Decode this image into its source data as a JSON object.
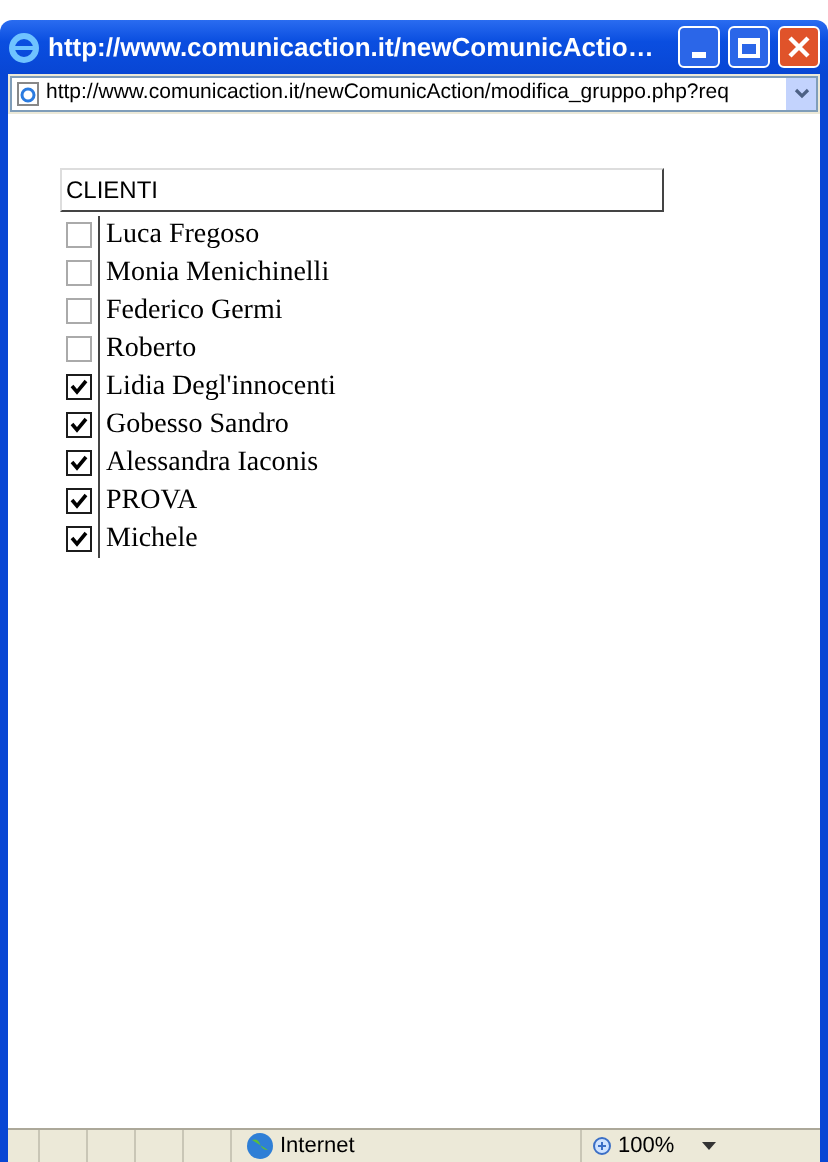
{
  "window": {
    "title": "http://www.comunicaction.it/newComunicActio…"
  },
  "address_bar": {
    "value": "http://www.comunicaction.it/newComunicAction/modifica_gruppo.php?req"
  },
  "table": {
    "header": "CLIENTI",
    "rows": [
      {
        "name": "Luca Fregoso",
        "checked": false
      },
      {
        "name": "Monia Menichinelli",
        "checked": false
      },
      {
        "name": "Federico Germi",
        "checked": false
      },
      {
        "name": "Roberto",
        "checked": false
      },
      {
        "name": "Lidia Degl'innocenti",
        "checked": true
      },
      {
        "name": "Gobesso Sandro",
        "checked": true
      },
      {
        "name": "Alessandra Iaconis",
        "checked": true
      },
      {
        "name": "PROVA",
        "checked": true
      },
      {
        "name": "Michele",
        "checked": true
      }
    ]
  },
  "status_bar": {
    "zone": "Internet",
    "zoom": "100%"
  }
}
